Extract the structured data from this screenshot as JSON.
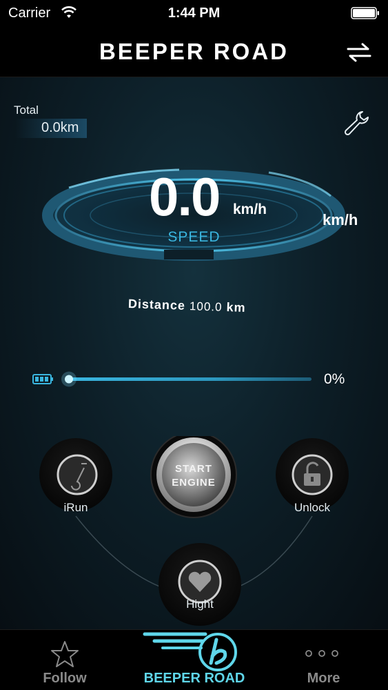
{
  "status_bar": {
    "carrier": "Carrier",
    "time": "1:44 PM"
  },
  "header": {
    "title": "BEEPER ROAD",
    "swap_icon": "swap-arrows-icon"
  },
  "dashboard": {
    "total_label": "Total",
    "total_value": "0.0km",
    "settings_icon": "wrench-icon",
    "speed_value": "0.0",
    "speed_unit": "km/h",
    "speed_unit_secondary": "km/h",
    "speed_label": "SPEED",
    "distance_label": "Distance",
    "distance_value": "100.0",
    "distance_unit": "km",
    "battery_percent_text": "0%",
    "battery_level": 0
  },
  "controls": {
    "irun_label": "iRun",
    "start_line1": "START",
    "start_line2": "ENGINE",
    "unlock_label": "Unlock",
    "hight_label": "Hight"
  },
  "tab_bar": {
    "follow": "Follow",
    "road": "BEEPER ROAD",
    "more": "More",
    "active": "road"
  },
  "colors": {
    "accent": "#3ab6e0",
    "tab_active": "#5fd6ea",
    "tab_inactive": "#8a8a8a"
  }
}
